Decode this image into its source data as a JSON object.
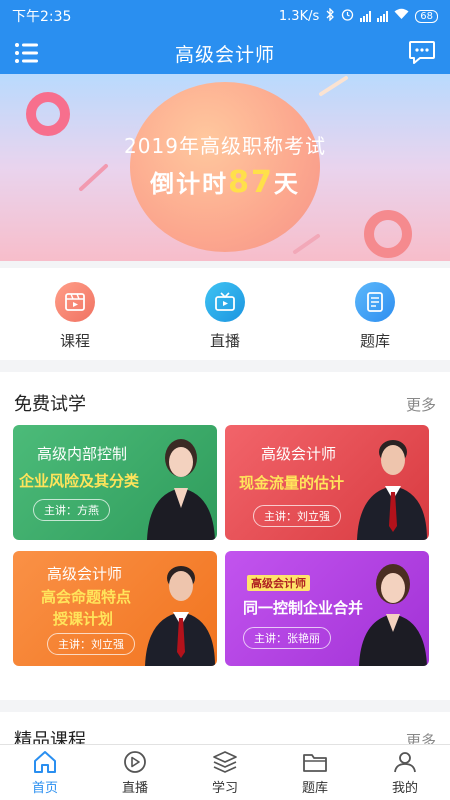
{
  "status_bar": {
    "time": "下午2:35",
    "speed": "1.3K/s",
    "battery": "68"
  },
  "header": {
    "title": "高级会计师"
  },
  "banner": {
    "line1": "2019年高级职称考试",
    "countdown_prefix": "倒计时",
    "days": "87",
    "countdown_suffix": "天"
  },
  "shortcuts": [
    {
      "label": "课程",
      "icon": "film-icon",
      "color": "#f58a72"
    },
    {
      "label": "直播",
      "icon": "tv-icon",
      "color": "#28a8e6"
    },
    {
      "label": "题库",
      "icon": "document-icon",
      "color": "#3ea2f5"
    }
  ],
  "free_trial": {
    "title": "免费试学",
    "more": "更多",
    "cards": [
      {
        "title": "高级内部控制",
        "subtitle": "企业风险及其分类",
        "lecturer": "主讲：方燕",
        "color": "#3fae6c"
      },
      {
        "title": "高级会计师",
        "subtitle": "现金流量的估计",
        "lecturer": "主讲：刘立强",
        "color": "#e24a4f"
      },
      {
        "title": "高级会计师",
        "subtitle": "高会命题特点",
        "subtitle2": "授课计划",
        "lecturer": "主讲：刘立强",
        "color": "#f6822f"
      },
      {
        "title": "高级会计师",
        "subtitle": "同一控制企业合并",
        "lecturer": "主讲：张艳丽",
        "color": "#b63fe0"
      }
    ]
  },
  "premium": {
    "title": "精品课程",
    "more": "更多"
  },
  "tabbar": [
    {
      "label": "首页",
      "icon": "home-icon",
      "active": true
    },
    {
      "label": "直播",
      "icon": "play-icon",
      "active": false
    },
    {
      "label": "学习",
      "icon": "layers-icon",
      "active": false
    },
    {
      "label": "题库",
      "icon": "folder-icon",
      "active": false
    },
    {
      "label": "我的",
      "icon": "user-icon",
      "active": false
    }
  ],
  "colors": {
    "primary": "#2a8ff0",
    "highlight": "#ffe45b"
  }
}
